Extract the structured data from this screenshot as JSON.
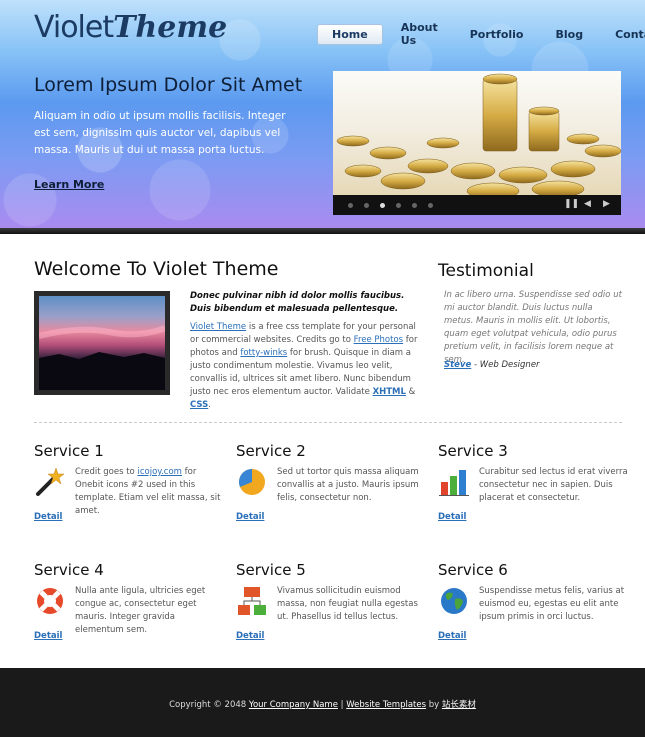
{
  "header": {
    "logo_light": "Violet",
    "logo_bold": "Theme",
    "nav": [
      "Home",
      "About Us",
      "Portfolio",
      "Blog",
      "Contact"
    ]
  },
  "hero": {
    "title": "Lorem Ipsum Dolor Sit Amet",
    "text": "Aliquam in odio ut ipsum mollis facilisis. Integer est sem, dignissim quis auctor vel, dapibus vel massa. Mauris ut dui ut massa porta luctus.",
    "link": "Learn More"
  },
  "slider": {
    "dots": 6,
    "active_dot": 2
  },
  "welcome": {
    "title": "Welcome To Violet Theme",
    "intro": "Donec pulvinar nibh id dolor mollis faucibus. Duis bibendum et malesuada pellentesque.",
    "link1": "Violet Theme",
    "text1": " is a free css template for your personal or commercial websites. Credits go to ",
    "link2": "Free Photos",
    "text2": " for photos and ",
    "link3": "fotty-winks",
    "text3": " for brush. Quisque in diam a justo condimentum molestie. Vivamus leo velit, convallis id, ultrices sit amet libero. Nunc bibendum justo nec eros elementum auctor. Validate ",
    "link4": "XHTML",
    "text4": " & ",
    "link5": "CSS",
    "text5": "."
  },
  "testimonial": {
    "title": "Testimonial",
    "quote": "In ac libero urna. Suspendisse sed odio ut mi auctor blandit. Duis luctus nulla metus. Mauris in mollis elit. Ut lobortis, quam eget volutpat vehicula, odio purus pretium velit, in facilisis lorem neque at sem.",
    "author_name": "Steve",
    "author_role": " - Web Designer"
  },
  "services": [
    {
      "title": "Service 1",
      "icon": "magic-wand-icon",
      "pre": "Credit goes to ",
      "link": "icojoy.com",
      "text": " for Onebit icons #2 used in this template. Etiam vel elit massa, sit amet.",
      "detail": "Detail"
    },
    {
      "title": "Service 2",
      "icon": "pie-chart-icon",
      "text": "Sed ut tortor quis massa aliquam convallis at a justo. Mauris ipsum felis, consectetur non.",
      "detail": "Detail"
    },
    {
      "title": "Service 3",
      "icon": "bar-chart-icon",
      "text": "Curabitur sed lectus id erat viverra consectetur nec in sapien. Duis placerat et consectetur.",
      "detail": "Detail"
    },
    {
      "title": "Service 4",
      "icon": "lifebuoy-icon",
      "text": "Nulla ante ligula, ultricies eget congue ac, consectetur eget mauris. Integer gravida elementum sem.",
      "detail": "Detail"
    },
    {
      "title": "Service 5",
      "icon": "sitemap-icon",
      "text": "Vivamus sollicitudin euismod massa, non feugiat nulla egestas ut. Phasellus id tellus lectus.",
      "detail": "Detail"
    },
    {
      "title": "Service 6",
      "icon": "globe-icon",
      "text": "Suspendisse metus felis, varius at euismod eu, egestas eu elit ante ipsum primis in orci luctus.",
      "detail": "Detail"
    }
  ],
  "footer": {
    "copyright": "Copyright © 2048 ",
    "company": "Your Company Name",
    "sep": " | ",
    "templates": "Website Templates",
    "by": " by ",
    "author": "站长素材"
  }
}
